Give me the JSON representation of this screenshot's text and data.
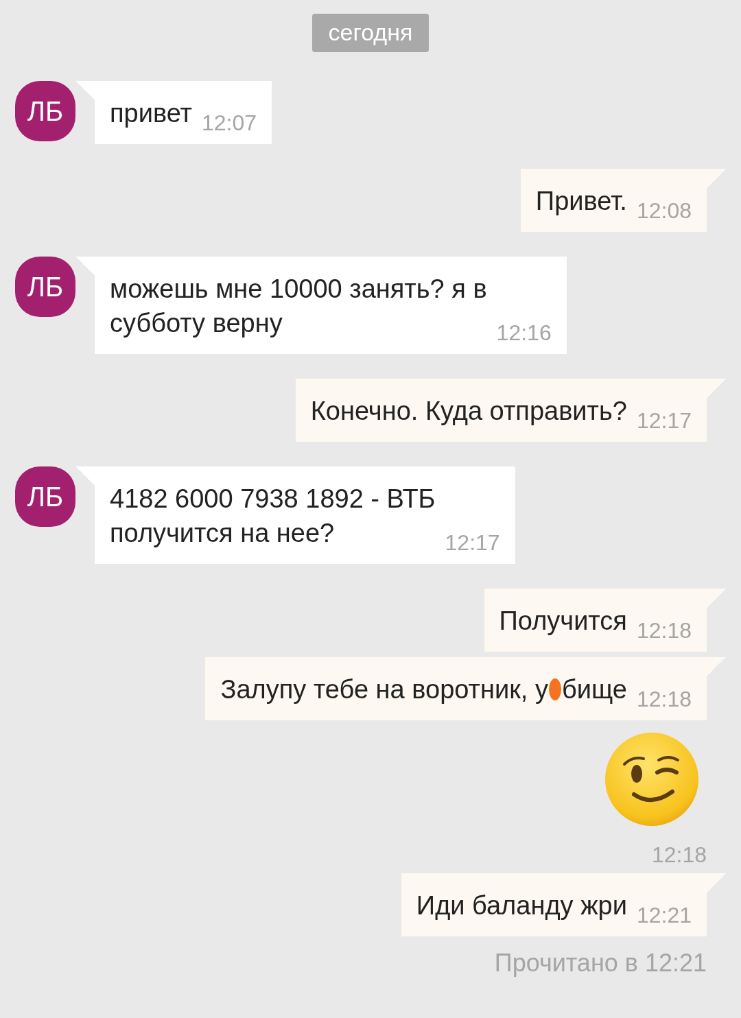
{
  "date_label": "сегодня",
  "messages": [
    {
      "outgoing": false,
      "kind": "text",
      "avatar": "ЛБ",
      "lines": [
        "привет"
      ],
      "time": "12:07"
    },
    {
      "outgoing": true,
      "kind": "text",
      "lines": [
        "Привет."
      ],
      "time": "12:08"
    },
    {
      "outgoing": false,
      "kind": "text",
      "avatar": "ЛБ",
      "lines": [
        "можешь мне 10000 занять? я в",
        "субботу верну"
      ],
      "time": "12:16"
    },
    {
      "outgoing": true,
      "kind": "text",
      "lines": [
        "Конечно. Куда отправить?"
      ],
      "time": "12:17"
    },
    {
      "outgoing": false,
      "kind": "text",
      "avatar": "ЛБ",
      "lines": [
        "4182 6000 7938 1892 - ВТБ",
        "получится на нее?"
      ],
      "time": "12:17"
    },
    {
      "outgoing": true,
      "kind": "text",
      "lines": [
        "Получится"
      ],
      "time": "12:18"
    },
    {
      "outgoing": true,
      "kind": "censored",
      "lines": [
        "Залупу тебе на воротник, у"
      ],
      "text_after": "бище",
      "time": "12:18"
    },
    {
      "outgoing": true,
      "kind": "emoji",
      "time": "12:18"
    },
    {
      "outgoing": true,
      "kind": "text",
      "lines": [
        "Иди баланду жри"
      ],
      "time": "12:21"
    }
  ],
  "read_receipt": "Прочитано в 12:21"
}
